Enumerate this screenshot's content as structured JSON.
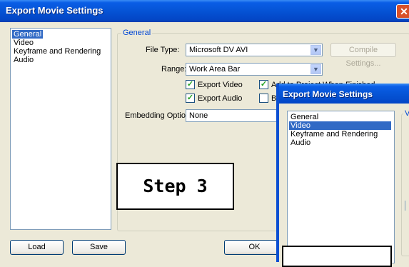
{
  "main_window": {
    "title": "Export Movie Settings",
    "close_glyph": "✕",
    "nav_items": [
      {
        "label": "General",
        "selected": true
      },
      {
        "label": "Video",
        "selected": false
      },
      {
        "label": "Keyframe and Rendering",
        "selected": false
      },
      {
        "label": "Audio",
        "selected": false
      }
    ],
    "group_title": "General",
    "file_type_label": "File Type:",
    "file_type_value": "Microsoft DV AVI",
    "compile_settings_label": "Compile Settings...",
    "range_label": "Range:",
    "range_value": "Work Area Bar",
    "export_video_label": "Export Video",
    "export_audio_label": "Export Audio",
    "add_to_project_label": "Add to Project When Finished",
    "beep_label": "Be",
    "embedding_label": "Embedding Options:",
    "embedding_value": "None",
    "load_label": "Load",
    "save_label": "Save",
    "ok_label": "OK"
  },
  "overlay": {
    "step_text": "Step 3"
  },
  "second_window": {
    "title": "Export Movie Settings",
    "nav_items": [
      {
        "label": "General",
        "selected": false
      },
      {
        "label": "Video",
        "selected": true
      },
      {
        "label": "Keyframe and Rendering",
        "selected": false
      },
      {
        "label": "Audio",
        "selected": false
      }
    ],
    "group_title_fragment": "V"
  },
  "icons": {
    "dropdown": "chevron-down-icon",
    "checkmark": "checkmark-icon"
  },
  "colors": {
    "titlebar_blue": "#0553d5",
    "selection_blue": "#316ac5",
    "group_title_blue": "#0046d5",
    "close_red": "#d8512a",
    "dialog_bg": "#ece9d8"
  }
}
